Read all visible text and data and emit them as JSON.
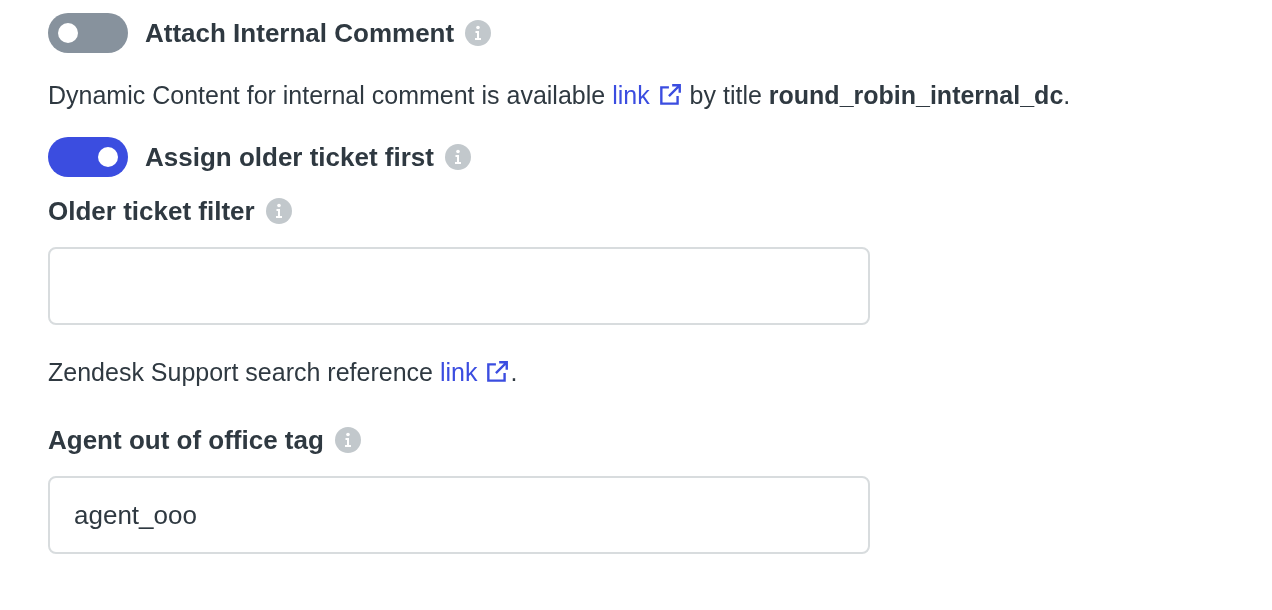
{
  "attach_comment_toggle": {
    "label": "Attach Internal Comment",
    "on": false
  },
  "dynamic_content_note": [
    {
      "kind": "text",
      "text": "Dynamic Content for internal comment is available "
    },
    {
      "kind": "link",
      "text": "link"
    },
    {
      "kind": "text",
      "text": " by title **round_robin_internal_dc**."
    }
  ],
  "older_ticket_toggle": {
    "label": "Assign older ticket first",
    "on": true
  },
  "older_ticket_filter": {
    "label": "Older ticket filter"
  },
  "search_reference_note": [
    {
      "kind": "text",
      "text": "Zendesk Support search reference "
    },
    {
      "kind": "link",
      "text": "link"
    },
    {
      "kind": "text",
      "text": "."
    }
  ],
  "out_of_office_tag": {
    "label": "Agent out of office tag",
    "value": "agent_ooo"
  }
}
